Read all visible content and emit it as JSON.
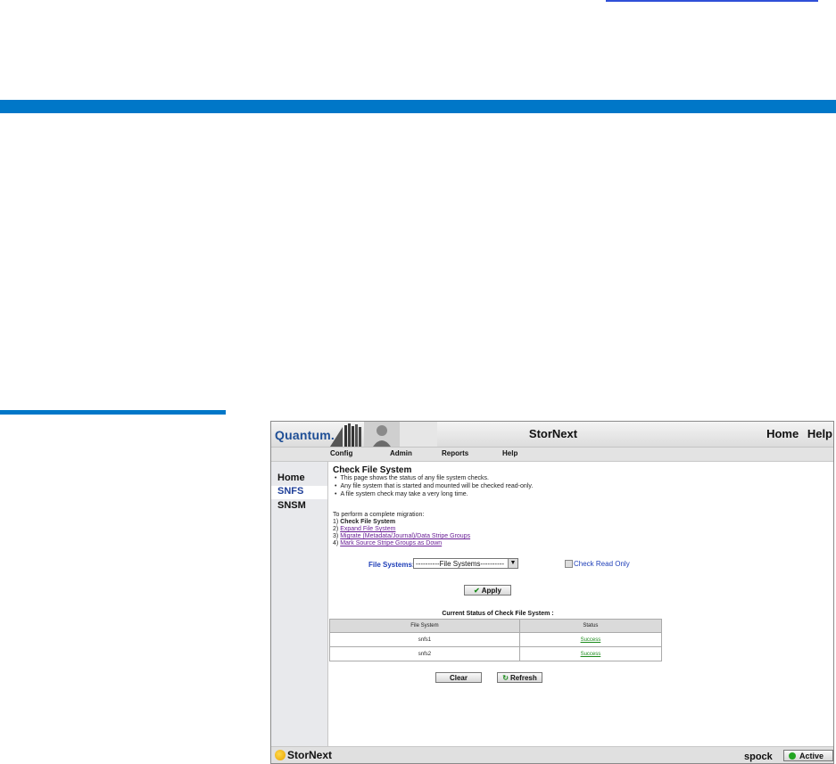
{
  "colors": {
    "accent": "#0077c8",
    "brand": "#1f4f96",
    "active_status": "#22a522",
    "link": "#6a1f96",
    "success": "#1b8a1b"
  },
  "header": {
    "brand": "Quantum.",
    "title": "StorNext",
    "home_link": "Home",
    "help_link": "Help"
  },
  "menu": [
    "Config",
    "Admin",
    "Reports",
    "Help"
  ],
  "sidebar": {
    "items": [
      {
        "label": "Home",
        "active": false
      },
      {
        "label": "SNFS",
        "active": true
      },
      {
        "label": "SNSM",
        "active": false
      }
    ]
  },
  "page": {
    "title": "Check File System",
    "bullets": [
      "This page shows the status of any file system checks.",
      "Any file system that is started and mounted will be checked read-only.",
      "A file system check may take a very long time."
    ],
    "migration_intro": "To perform a complete migration:",
    "steps": [
      {
        "num": "1)",
        "label": "Check File System",
        "link": false
      },
      {
        "num": "2)",
        "label": "Expand File System",
        "link": true
      },
      {
        "num": "3)",
        "label": "Migrate (Metadata/Journal)/Data Stripe Groups",
        "link": true
      },
      {
        "num": "4)",
        "label": "Mark Source Stripe Groups as Down",
        "link": true
      }
    ],
    "fs_label": "File Systems:",
    "fs_select_value": "----------File Systems----------",
    "check_read_only": "Check Read Only",
    "apply": "Apply",
    "table_title": "Current Status of Check File System :",
    "table_headers": [
      "File System",
      "Status"
    ],
    "rows": [
      [
        "snfs1",
        "Success"
      ],
      [
        "snfs2",
        "Success"
      ]
    ],
    "clear": "Clear",
    "refresh": "Refresh"
  },
  "footer": {
    "logo": "StorNext",
    "host": "spock",
    "status": "Active"
  }
}
